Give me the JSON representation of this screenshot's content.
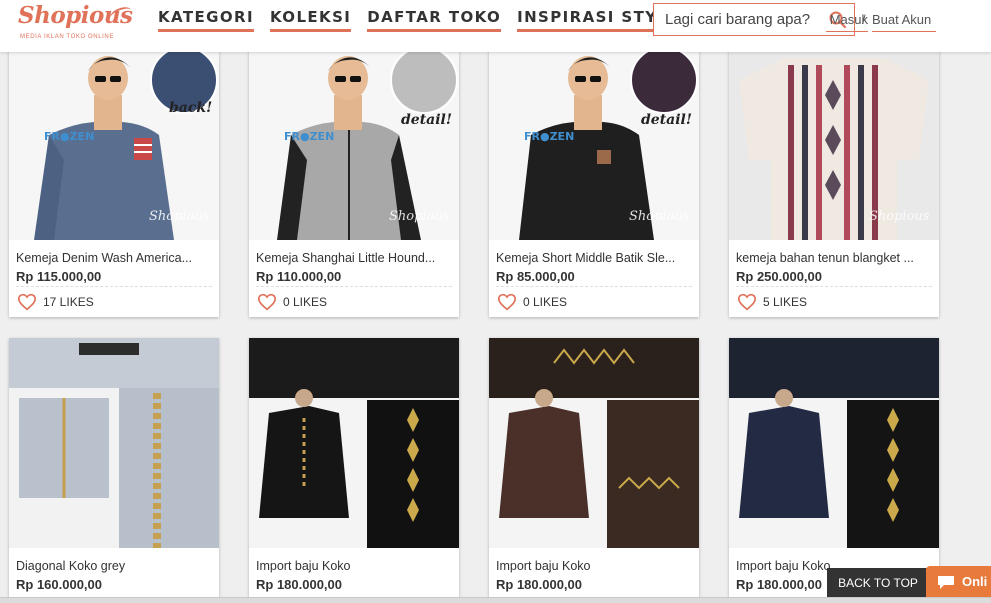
{
  "header": {
    "logo_text": "Shopious",
    "logo_tagline": "MEDIA IKLAN TOKO ONLINE",
    "nav": [
      "KATEGORI",
      "KOLEKSI",
      "DAFTAR TOKO",
      "INSPIRASI STYLE"
    ],
    "search_placeholder": "Lagi cari barang apa?",
    "login_label": "Masuk",
    "separator": "/",
    "signup_label": "Buat Akun"
  },
  "products": [
    {
      "title": "Kemeja Denim Wash America...",
      "price": "Rp 115.000,00",
      "likes": "17 LIKES",
      "image_caption": "back!"
    },
    {
      "title": "Kemeja Shanghai Little Hound...",
      "price": "Rp 110.000,00",
      "likes": "0 LIKES",
      "image_caption": "detail!"
    },
    {
      "title": "Kemeja Short Middle Batik Sle...",
      "price": "Rp 85.000,00",
      "likes": "0 LIKES",
      "image_caption": "detail!"
    },
    {
      "title": "kemeja bahan tenun blangket ...",
      "price": "Rp 250.000,00",
      "likes": "5 LIKES",
      "image_caption": ""
    },
    {
      "title": "Diagonal Koko grey",
      "price": "Rp 160.000,00",
      "likes": "",
      "image_caption": ""
    },
    {
      "title": "Import baju Koko",
      "price": "Rp 180.000,00",
      "likes": "",
      "image_caption": ""
    },
    {
      "title": "Import  baju Koko",
      "price": "Rp 180.000,00",
      "likes": "",
      "image_caption": ""
    },
    {
      "title": "Import baju Koko",
      "price": "Rp 180.000,00",
      "likes": "",
      "image_caption": ""
    }
  ],
  "watermark": "Shopious",
  "back_to_top": "BACK TO TOP",
  "chat_label": "Onli",
  "colors": {
    "accent": "#e0725a",
    "chat": "#e87a3c"
  },
  "icons": {
    "search": "search-icon",
    "like": "heart-outline-icon",
    "chat": "chat-bubble-icon"
  }
}
